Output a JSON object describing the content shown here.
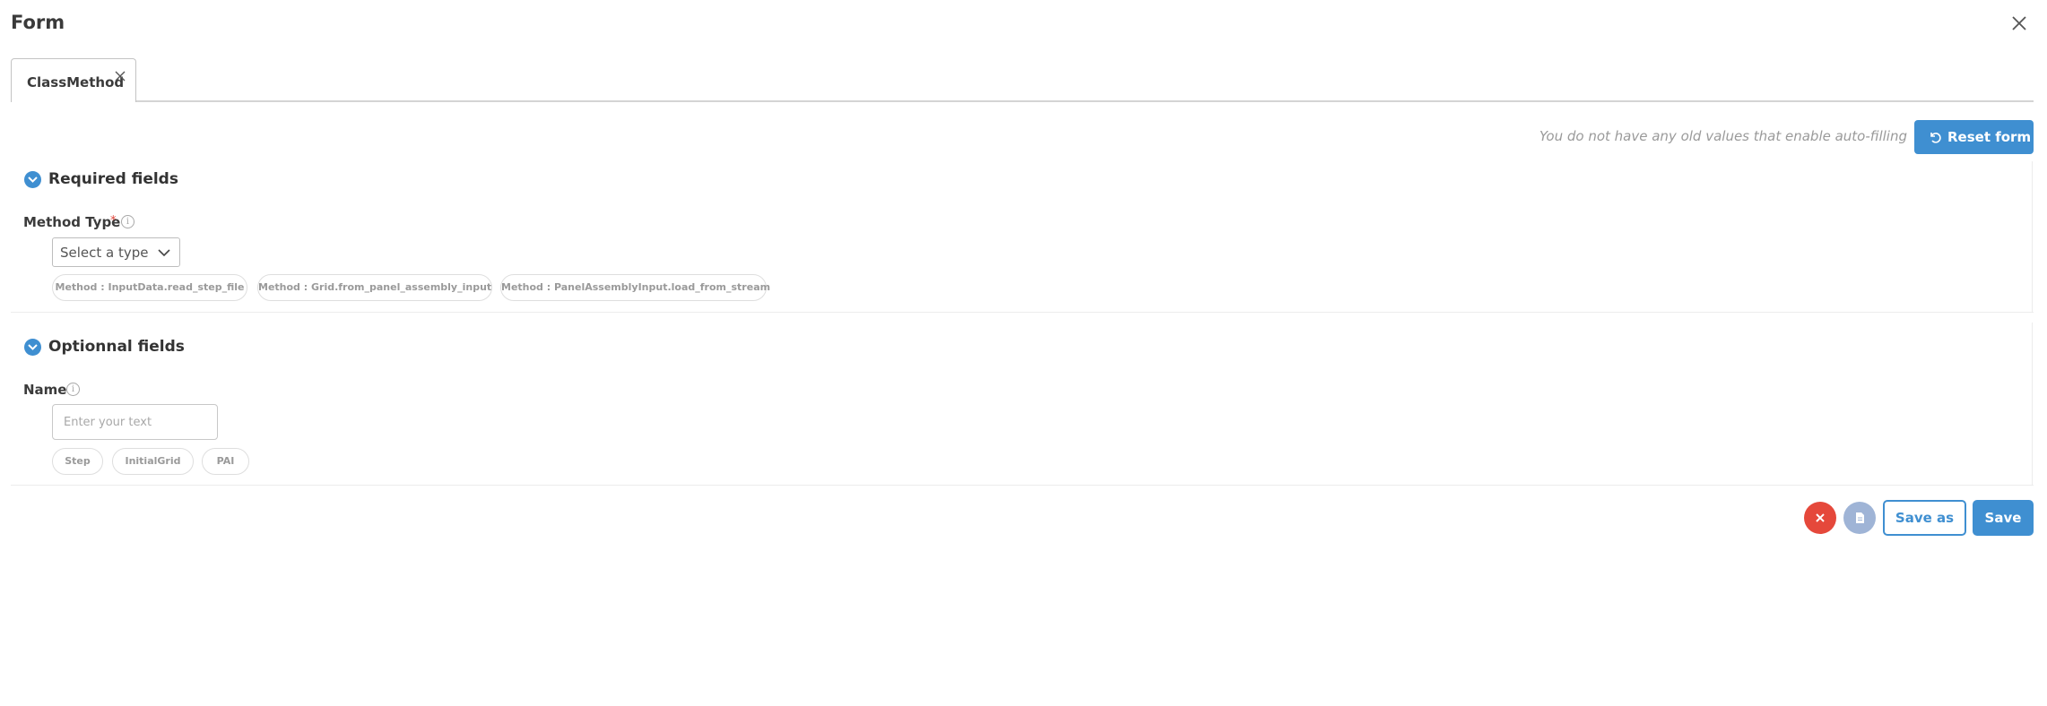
{
  "header": {
    "title": "Form",
    "close_icon": "close-icon"
  },
  "tabs": [
    {
      "label": "ClassMethod",
      "active": true
    }
  ],
  "autofill": {
    "hint": "You do not have any old values that enable auto-filling",
    "reset_label": "Reset form",
    "reset_icon": "undo-icon"
  },
  "required_section": {
    "title": "Required fields",
    "icon": "chevron-down-circle-icon",
    "method_type": {
      "label": "Method Type",
      "required_mark": "*",
      "info_icon": "info-icon",
      "select_value": "Select a type",
      "suggestions": [
        "Method : InputData.read_step_file",
        "Method : Grid.from_panel_assembly_input",
        "Method : PanelAssemblyInput.load_from_stream"
      ]
    }
  },
  "optional_section": {
    "title": "Optionnal fields",
    "icon": "chevron-down-circle-icon",
    "name": {
      "label": "Name",
      "info_icon": "info-icon",
      "placeholder": "Enter your text",
      "value": "",
      "suggestions": [
        "Step",
        "InitialGrid",
        "PAI"
      ]
    }
  },
  "footer": {
    "cancel_icon": "close-icon",
    "document_icon": "document-icon",
    "save_as_label": "Save as",
    "save_label": "Save"
  },
  "colors": {
    "accent": "#3f8fd1",
    "danger": "#e5483b",
    "muted_button": "#9fb4d6",
    "required": "#e0453a"
  }
}
